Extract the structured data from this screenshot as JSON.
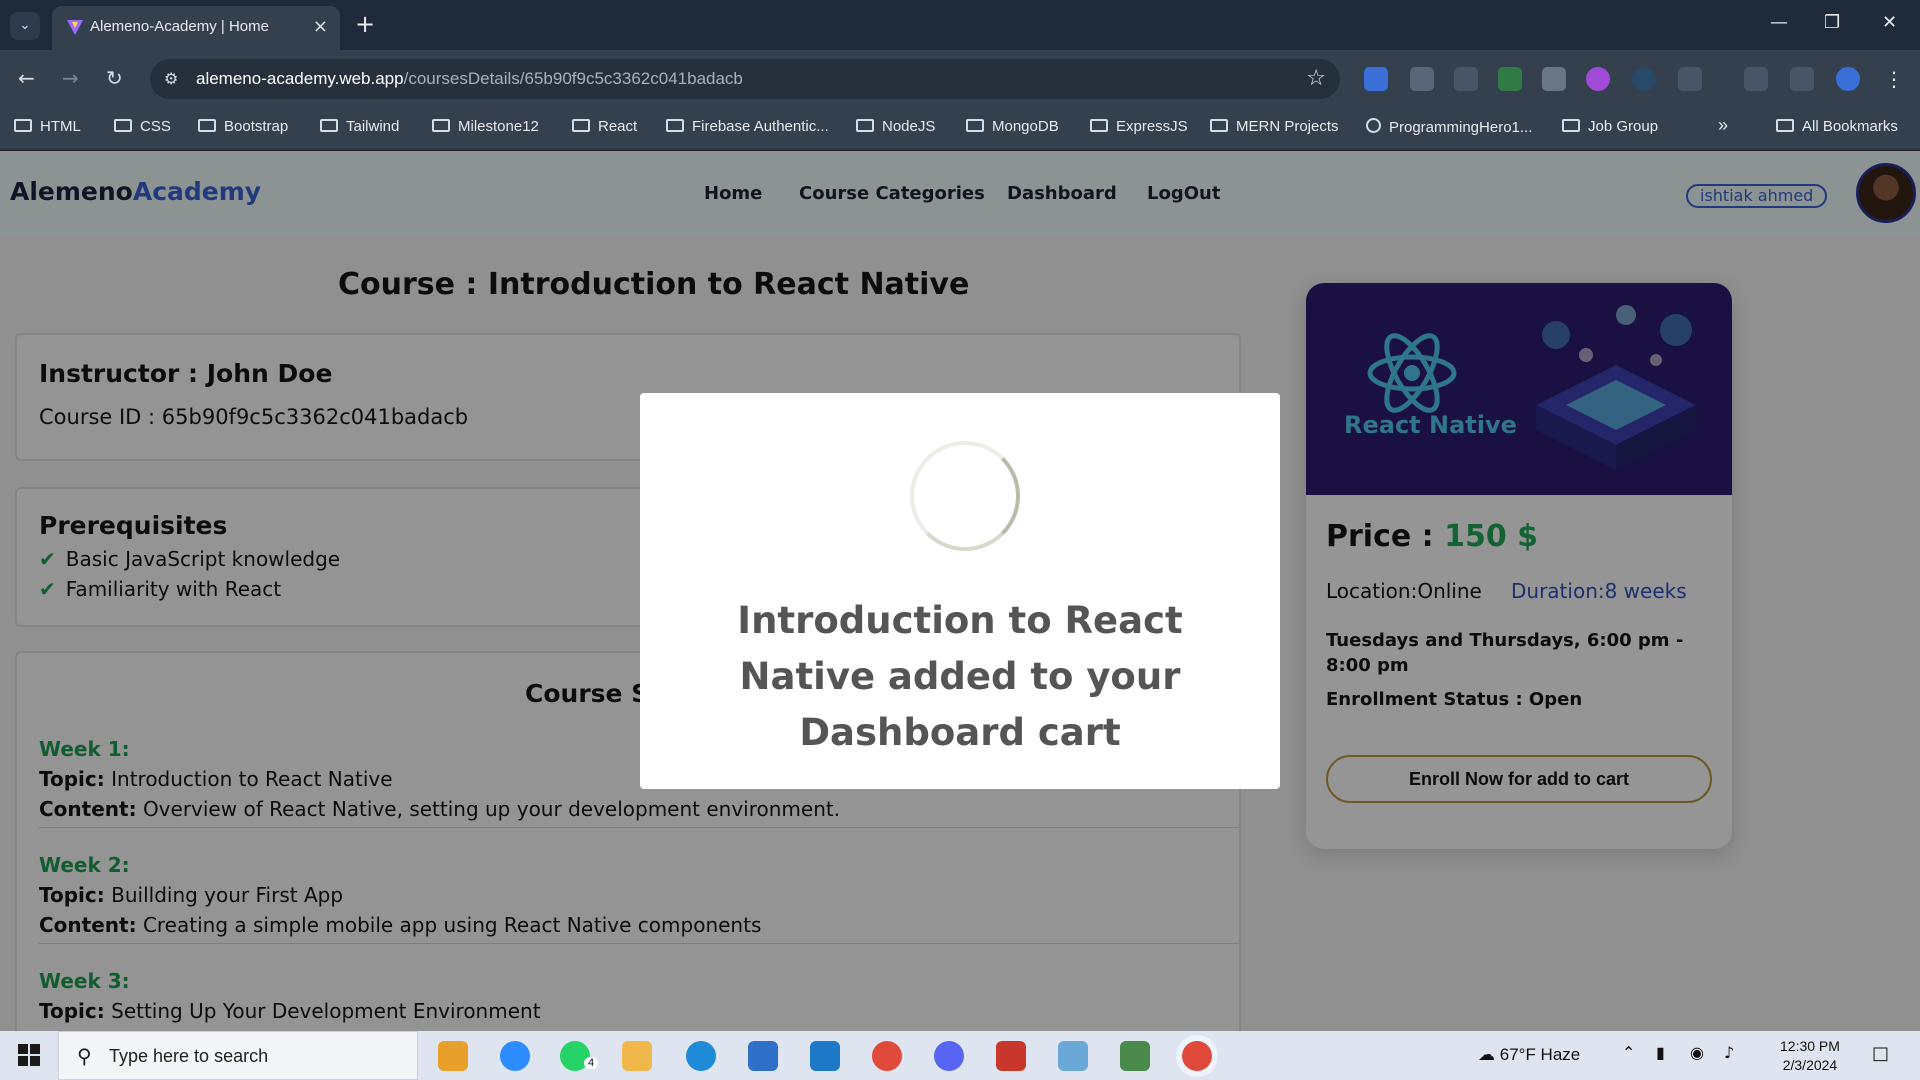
{
  "browser": {
    "tab_title": "Alemeno-Academy | Home",
    "url_host": "alemeno-academy.web.app",
    "url_path": "/coursesDetails/65b90f9c5c3362c041badacb",
    "bookmarks": [
      "HTML",
      "CSS",
      "Bootstrap",
      "Tailwind",
      "Milestone12",
      "React",
      "Firebase Authentic...",
      "NodeJS",
      "MongoDB",
      "ExpressJS",
      "MERN Projects",
      "ProgrammingHero1...",
      "Job Group"
    ],
    "all_bookmarks": "All Bookmarks",
    "more_bookmarks": "»"
  },
  "site": {
    "logo_part1": "Alemeno",
    "logo_part2": "Academy",
    "nav": [
      "Home",
      "Course Categories",
      "Dashboard",
      "LogOut"
    ],
    "user_name": "ishtiak ahmed"
  },
  "course": {
    "title": "Course : Introduction to React Native",
    "instructor": "Instructor : John Doe",
    "course_id": "Course ID : 65b90f9c5c3362c041badacb",
    "prereq_title": "Prerequisites",
    "prerequisites": [
      "Basic JavaScript knowledge",
      "Familiarity with React"
    ],
    "syllabus_title": "Course Syllabus",
    "topic_label": "Topic:",
    "content_label": "Content:",
    "weeks": [
      {
        "label": "Week 1:",
        "topic": "Introduction to React Native",
        "content": "Overview of React Native, setting up your development environment."
      },
      {
        "label": "Week 2:",
        "topic": "Buillding your First App",
        "content": "Creating a simple mobile app using React Native components"
      },
      {
        "label": "Week 3:",
        "topic": "Setting Up Your Development Environment",
        "content": ""
      }
    ]
  },
  "sidebar": {
    "banner_label": "React Native",
    "price_label": "Price :",
    "price_value": "150 $",
    "location": "Location:Online",
    "duration": "Duration:8 weeks",
    "schedule": "Tuesdays and Thursdays, 6:00 pm - 8:00 pm",
    "enrollment_status": "Enrollment Status : Open",
    "enroll_button": "Enroll Now for add to cart"
  },
  "modal": {
    "message": "Introduction to React Native added to your Dashboard cart"
  },
  "taskbar": {
    "search_placeholder": "Type here to search",
    "weather": "67°F  Haze",
    "time": "12:30 PM",
    "date": "2/3/2024",
    "whatsapp_badge": "4"
  },
  "colors": {
    "accent_green": "#22a356",
    "brand_blue": "#3a5fd0",
    "banner_purple": "#2d1b6e"
  }
}
